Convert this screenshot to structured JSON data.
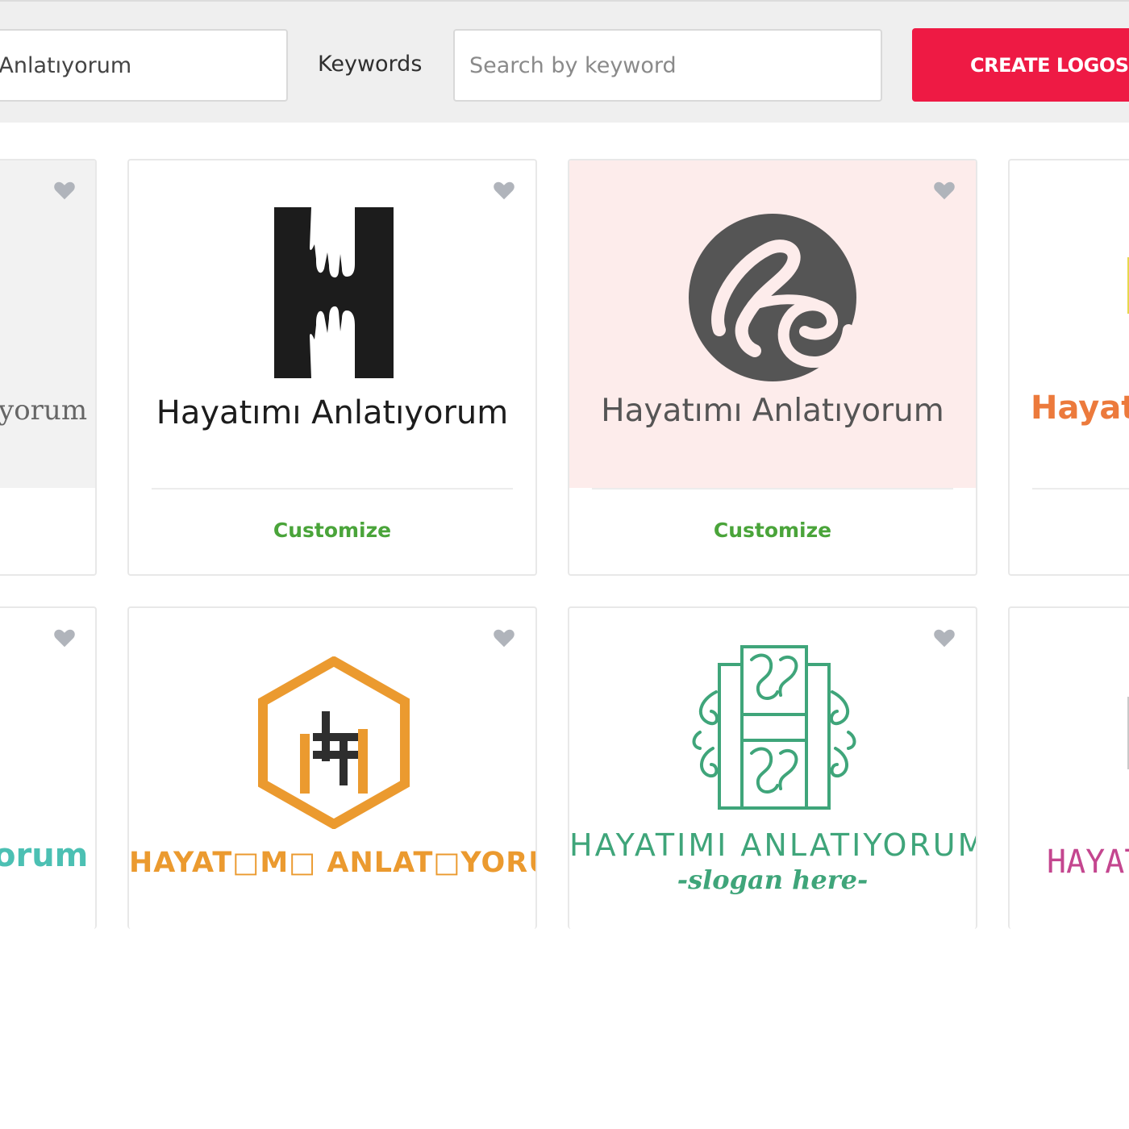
{
  "search": {
    "name_value": "mı Anlatıyorum",
    "keywords_label": "Keywords",
    "keywords_placeholder": "Search by keyword",
    "create_button": "CREATE LOGOS"
  },
  "colors": {
    "accent": "#ee1a44",
    "customize_green": "#4aa43a",
    "heart_gray": "#b0b4bb",
    "pink_bg": "#fdeceb",
    "gray_bg": "#f2f2f2"
  },
  "cards_row1": [
    {
      "brand_partial": "yorum",
      "icon": "heart-icon"
    },
    {
      "brand": "Hayatımı Anlatıyorum",
      "customize": "Customize",
      "icon": "heart-icon",
      "logo": "h-hands-logo"
    },
    {
      "brand": "Hayatımı Anlatıyorum",
      "customize": "Customize",
      "icon": "heart-icon",
      "logo": "he-monogram-logo"
    },
    {
      "brand_partial": "Hayat"
    }
  ],
  "cards_row2": [
    {
      "brand_partial": "orum",
      "icon": "heart-icon"
    },
    {
      "brand": "HAYAT□M□ ANLAT□YORUM",
      "icon": "heart-icon",
      "logo": "hexagon-h-logo"
    },
    {
      "brand": "HAYATIMI ANLATIYORUM",
      "slogan": "-slogan here-",
      "icon": "heart-icon",
      "logo": "ornamental-h-logo"
    },
    {
      "brand_partial": "HAYAT"
    }
  ]
}
